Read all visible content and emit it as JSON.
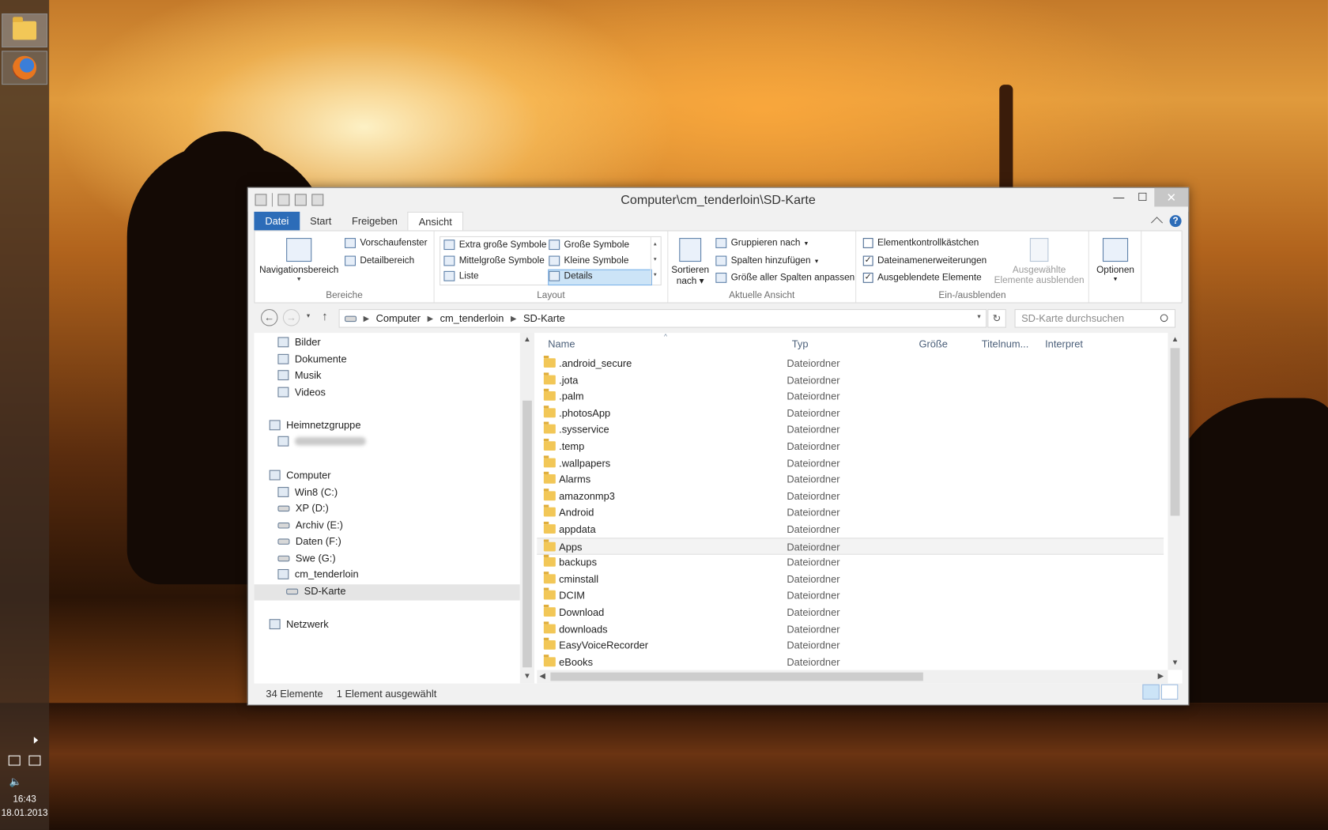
{
  "taskbar": {
    "items": [
      {
        "name": "Explorer",
        "icon": "folder-icon"
      },
      {
        "name": "Firefox",
        "icon": "firefox-icon"
      }
    ],
    "clock_time": "16:43",
    "clock_date": "18.01.2013"
  },
  "window": {
    "title": "Computer\\cm_tenderloin\\SD-Karte",
    "min_label": "—",
    "max_label": "☐",
    "close_label": "✕"
  },
  "ribbon": {
    "tabs": [
      "Datei",
      "Start",
      "Freigeben",
      "Ansicht"
    ],
    "active_tab": "Ansicht",
    "help_label": "?",
    "bereiche": {
      "navigationsbereich": "Navigationsbereich",
      "vorschaufenster": "Vorschaufenster",
      "detailbereich": "Detailbereich",
      "label": "Bereiche"
    },
    "layout": {
      "options": [
        "Extra große Symbole",
        "Große Symbole",
        "Mittelgroße Symbole",
        "Kleine Symbole",
        "Liste",
        "Details"
      ],
      "selected": "Details",
      "label": "Layout"
    },
    "aktuelle_ansicht": {
      "sortieren": "Sortieren",
      "nach": "nach",
      "gruppieren": "Gruppieren nach",
      "spalten": "Spalten hinzufügen",
      "groesse": "Größe aller Spalten anpassen",
      "label": "Aktuelle Ansicht"
    },
    "ein_ausblenden": {
      "elementkontrollkaestchen": {
        "label": "Elementkontrollkästchen",
        "checked": false
      },
      "dateinamenerweiterungen": {
        "label": "Dateinamenerweiterungen",
        "checked": true
      },
      "ausgeblendete_elemente": {
        "label": "Ausgeblendete Elemente",
        "checked": true
      },
      "ausgewaehlte_1": "Ausgewählte",
      "ausgewaehlte_2": "Elemente ausblenden",
      "label": "Ein-/ausblenden"
    },
    "optionen": "Optionen"
  },
  "address": {
    "crumbs": [
      "Computer",
      "cm_tenderloin",
      "SD-Karte"
    ],
    "search_placeholder": "SD-Karte durchsuchen"
  },
  "navpane": {
    "library": [
      "Bilder",
      "Dokumente",
      "Musik",
      "Videos"
    ],
    "heimnetzgruppe": "Heimnetzgruppe",
    "computer": "Computer",
    "drives": [
      "Win8 (C:)",
      "XP (D:)",
      "Archiv (E:)",
      "Daten (F:)",
      "Swe (G:)",
      "cm_tenderloin",
      "SD-Karte"
    ],
    "netzwerk": "Netzwerk"
  },
  "files": {
    "columns": [
      "Name",
      "Typ",
      "Größe",
      "Titelnum...",
      "Interpret"
    ],
    "sort_arrow": "^",
    "rows": [
      {
        "name": ".android_secure",
        "type": "Dateiordner"
      },
      {
        "name": ".jota",
        "type": "Dateiordner"
      },
      {
        "name": ".palm",
        "type": "Dateiordner"
      },
      {
        "name": ".photosApp",
        "type": "Dateiordner"
      },
      {
        "name": ".sysservice",
        "type": "Dateiordner"
      },
      {
        "name": ".temp",
        "type": "Dateiordner"
      },
      {
        "name": ".wallpapers",
        "type": "Dateiordner"
      },
      {
        "name": "Alarms",
        "type": "Dateiordner"
      },
      {
        "name": "amazonmp3",
        "type": "Dateiordner"
      },
      {
        "name": "Android",
        "type": "Dateiordner"
      },
      {
        "name": "appdata",
        "type": "Dateiordner"
      },
      {
        "name": "Apps",
        "type": "Dateiordner"
      },
      {
        "name": "backups",
        "type": "Dateiordner"
      },
      {
        "name": "cminstall",
        "type": "Dateiordner"
      },
      {
        "name": "DCIM",
        "type": "Dateiordner"
      },
      {
        "name": "Download",
        "type": "Dateiordner"
      },
      {
        "name": "downloads",
        "type": "Dateiordner"
      },
      {
        "name": "EasyVoiceRecorder",
        "type": "Dateiordner"
      },
      {
        "name": "eBooks",
        "type": "Dateiordner"
      }
    ],
    "selected": "Apps"
  },
  "status": {
    "count": "34 Elemente",
    "selection": "1 Element ausgewählt"
  }
}
